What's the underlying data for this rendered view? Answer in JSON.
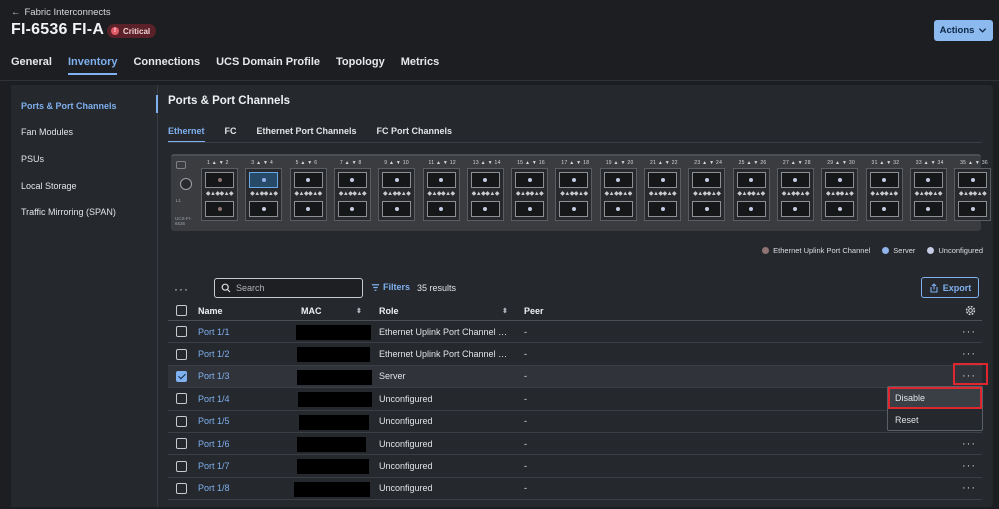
{
  "header": {
    "back_label": "Fabric Interconnects",
    "title": "FI-6536 FI-A",
    "badge": "Critical",
    "actions_label": "Actions"
  },
  "tabs": [
    {
      "label": "General"
    },
    {
      "label": "Inventory",
      "active": true
    },
    {
      "label": "Connections"
    },
    {
      "label": "UCS Domain Profile"
    },
    {
      "label": "Topology"
    },
    {
      "label": "Metrics"
    }
  ],
  "sidebar": {
    "items": [
      {
        "label": "Ports & Port Channels",
        "active": true
      },
      {
        "label": "Fan Modules"
      },
      {
        "label": "PSUs"
      },
      {
        "label": "Local Storage"
      },
      {
        "label": "Traffic Mirroring (SPAN)"
      }
    ]
  },
  "section": {
    "title": "Ports & Port Channels",
    "subtabs": [
      {
        "label": "Ethernet",
        "active": true
      },
      {
        "label": "FC"
      },
      {
        "label": "Ethernet Port Channels"
      },
      {
        "label": "FC Port Channels"
      }
    ]
  },
  "switch": {
    "model_label": "UCS-FI-6536",
    "port_labels": [
      "1",
      "2",
      "3",
      "4",
      "5",
      "6",
      "7",
      "8",
      "9",
      "10",
      "11",
      "12",
      "13",
      "14",
      "15",
      "16",
      "17",
      "18",
      "19",
      "20",
      "21",
      "22",
      "23",
      "24",
      "25",
      "26",
      "27",
      "28",
      "29",
      "30",
      "31",
      "32",
      "33",
      "34",
      "35",
      "36"
    ],
    "port_status": [
      "uplink",
      "uplink",
      "server",
      "unconfigured",
      "unconfigured",
      "unconfigured",
      "unconfigured",
      "unconfigured",
      "unconfigured",
      "unconfigured",
      "unconfigured",
      "unconfigured",
      "unconfigured",
      "unconfigured",
      "unconfigured",
      "unconfigured",
      "unconfigured",
      "unconfigured",
      "unconfigured",
      "unconfigured",
      "unconfigured",
      "unconfigured",
      "unconfigured",
      "unconfigured",
      "unconfigured",
      "unconfigured",
      "unconfigured",
      "unconfigured",
      "unconfigured",
      "unconfigured",
      "unconfigured",
      "unconfigured",
      "unconfigured",
      "unconfigured",
      "unconfigured",
      "unconfigured"
    ],
    "selected_port": 3
  },
  "legend": [
    {
      "label": "Ethernet Uplink Port Channel",
      "color": "#8f7474"
    },
    {
      "label": "Server",
      "color": "#8fb3ea"
    },
    {
      "label": "Unconfigured",
      "color": "#c6cce4"
    }
  ],
  "toolbar": {
    "search_placeholder": "Search",
    "filters_label": "Filters",
    "results": "35 results",
    "export_label": "Export"
  },
  "table": {
    "headers": {
      "name": "Name",
      "mac": "MAC",
      "role": "Role",
      "peer": "Peer"
    },
    "rows": [
      {
        "name": "Port 1/1",
        "role": "Ethernet Uplink Port Channel Member",
        "peer": "-",
        "checked": false
      },
      {
        "name": "Port 1/2",
        "role": "Ethernet Uplink Port Channel Member",
        "peer": "-",
        "checked": false
      },
      {
        "name": "Port 1/3",
        "role": "Server",
        "peer": "-",
        "checked": true
      },
      {
        "name": "Port 1/4",
        "role": "Unconfigured",
        "peer": "-",
        "checked": false
      },
      {
        "name": "Port 1/5",
        "role": "Unconfigured",
        "peer": "-",
        "checked": false
      },
      {
        "name": "Port 1/6",
        "role": "Unconfigured",
        "peer": "-",
        "checked": false
      },
      {
        "name": "Port 1/7",
        "role": "Unconfigured",
        "peer": "-",
        "checked": false
      },
      {
        "name": "Port 1/8",
        "role": "Unconfigured",
        "peer": "-",
        "checked": false
      }
    ]
  },
  "context_menu": {
    "items": [
      {
        "label": "Disable"
      },
      {
        "label": "Reset"
      }
    ]
  }
}
